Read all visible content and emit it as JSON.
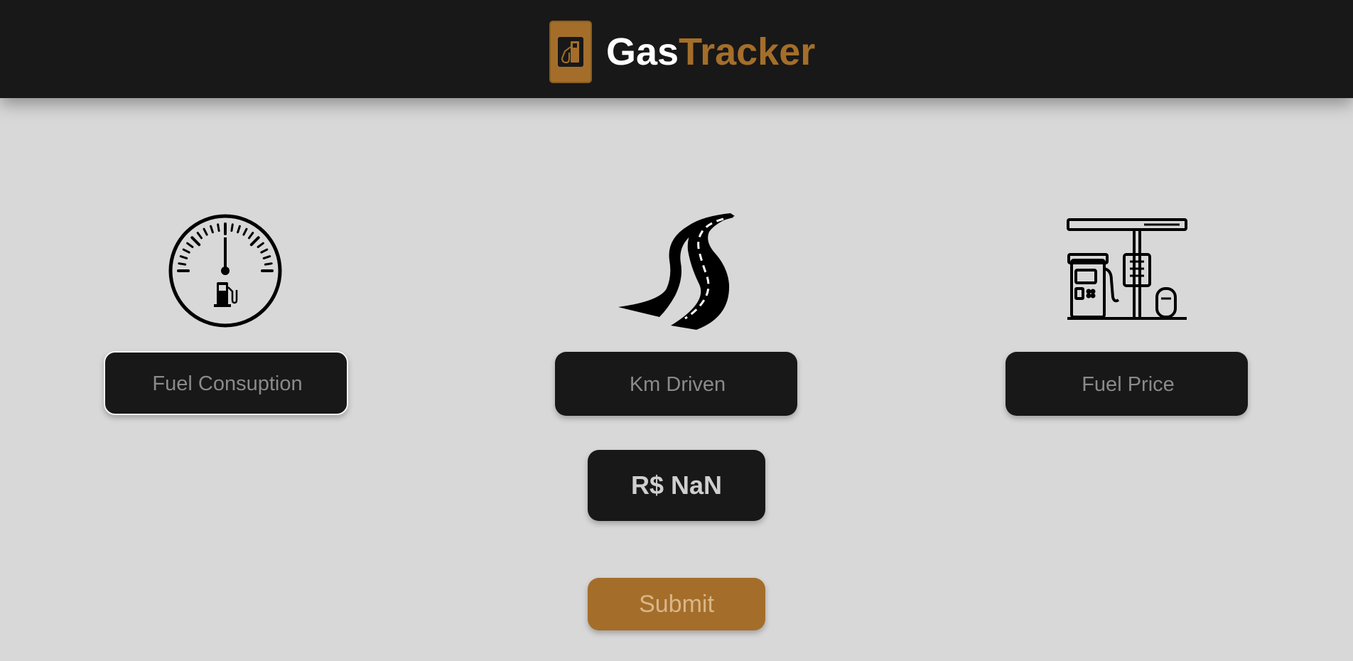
{
  "header": {
    "logo_icon": "fuel-pump-icon",
    "brand_part1": "Gas",
    "brand_part2": "Tracker"
  },
  "icons": {
    "consumption": "fuel-gauge-icon",
    "distance": "road-icon",
    "price": "gas-station-icon"
  },
  "inputs": {
    "fuel_consumption": {
      "placeholder": "Fuel Consuption",
      "value": ""
    },
    "km_driven": {
      "placeholder": "Km Driven",
      "value": ""
    },
    "fuel_price": {
      "placeholder": "Fuel Price",
      "value": ""
    }
  },
  "result": {
    "text": "R$ NaN"
  },
  "submit": {
    "label": "Submit"
  },
  "colors": {
    "header_bg": "#181818",
    "page_bg": "#d8d8d8",
    "accent": "#a46e2a",
    "field_bg": "#181818"
  }
}
